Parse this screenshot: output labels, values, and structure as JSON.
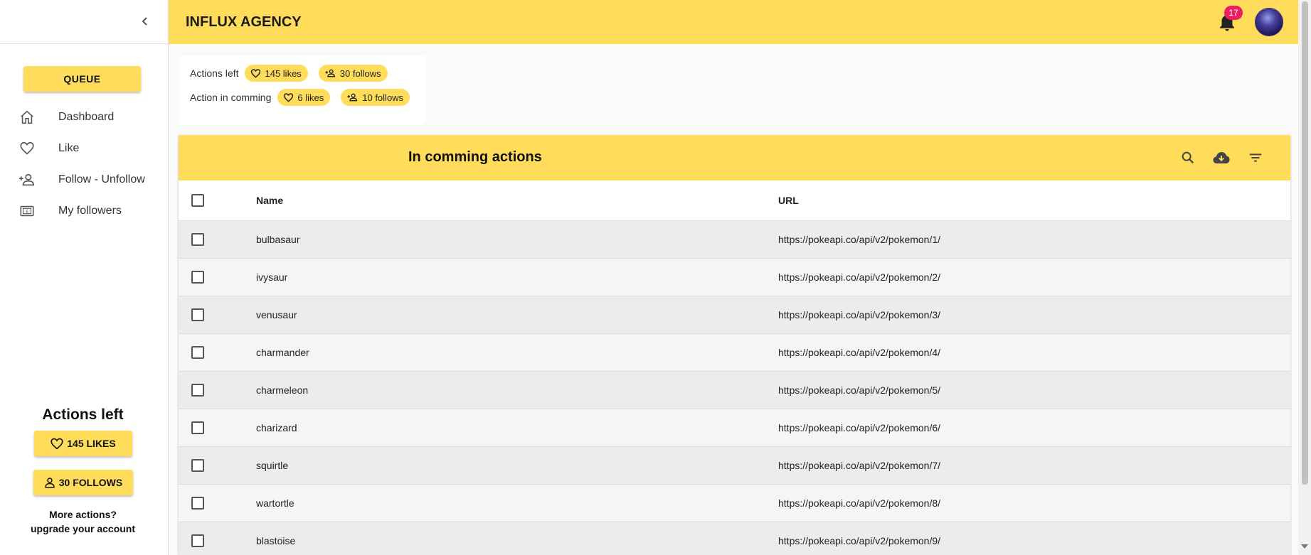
{
  "app": {
    "title": "INFLUX AGENCY"
  },
  "notifications": {
    "count": "17"
  },
  "sidebar": {
    "queue_label": "QUEUE",
    "items": [
      {
        "label": "Dashboard",
        "icon": "home-icon"
      },
      {
        "label": "Like",
        "icon": "heart-icon"
      },
      {
        "label": "Follow - Unfollow",
        "icon": "person-add-icon"
      },
      {
        "label": "My followers",
        "icon": "money-icon"
      }
    ],
    "actions_left": {
      "title": "Actions left",
      "likes_label": "145 LIKES",
      "follows_label": "30 FOLLOWS",
      "more_line1": "More actions?",
      "more_line2": "upgrade your account"
    }
  },
  "summary": {
    "actions_left_label": "Actions left",
    "actions_left_likes": "145 likes",
    "actions_left_follows": "30 follows",
    "incoming_label": "Action in comming",
    "incoming_likes": "6 likes",
    "incoming_follows": "10 follows"
  },
  "table": {
    "title": "In comming actions",
    "columns": {
      "name": "Name",
      "url": "URL"
    },
    "rows": [
      {
        "name": "bulbasaur",
        "url": "https://pokeapi.co/api/v2/pokemon/1/"
      },
      {
        "name": "ivysaur",
        "url": "https://pokeapi.co/api/v2/pokemon/2/"
      },
      {
        "name": "venusaur",
        "url": "https://pokeapi.co/api/v2/pokemon/3/"
      },
      {
        "name": "charmander",
        "url": "https://pokeapi.co/api/v2/pokemon/4/"
      },
      {
        "name": "charmeleon",
        "url": "https://pokeapi.co/api/v2/pokemon/5/"
      },
      {
        "name": "charizard",
        "url": "https://pokeapi.co/api/v2/pokemon/6/"
      },
      {
        "name": "squirtle",
        "url": "https://pokeapi.co/api/v2/pokemon/7/"
      },
      {
        "name": "wartortle",
        "url": "https://pokeapi.co/api/v2/pokemon/8/"
      },
      {
        "name": "blastoise",
        "url": "https://pokeapi.co/api/v2/pokemon/9/"
      }
    ]
  },
  "colors": {
    "accent": "#ffdc5a",
    "badge": "#e91e63"
  }
}
